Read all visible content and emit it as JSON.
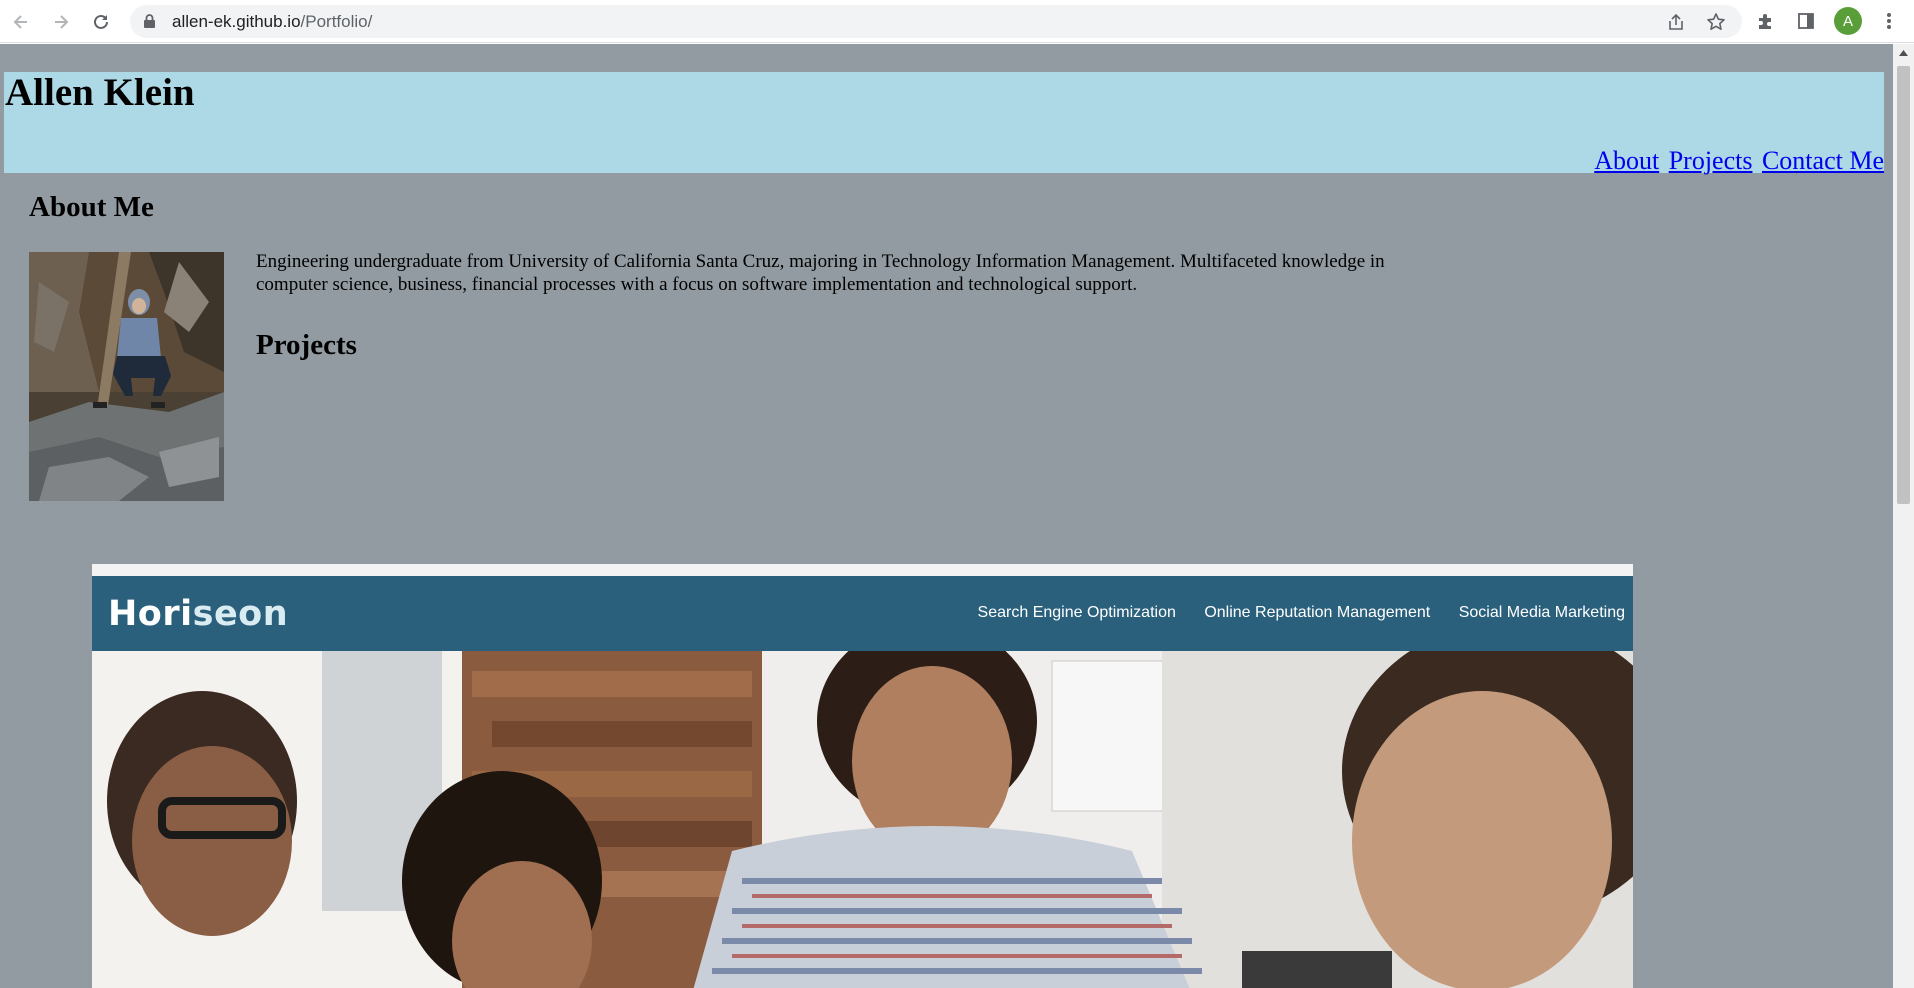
{
  "browser": {
    "url_host": "allen-ek.github.io",
    "url_path": "/Portfolio/",
    "avatar_letter": "A",
    "icons": [
      "back-arrow-icon",
      "forward-arrow-icon",
      "reload-icon",
      "lock-icon",
      "share-icon",
      "star-icon",
      "extensions-icon",
      "side-panel-icon",
      "kebab-menu-icon"
    ]
  },
  "header": {
    "title": "Allen Klein",
    "nav": [
      "About",
      "Projects",
      "Contact Me"
    ]
  },
  "about": {
    "heading": "About Me",
    "bio": "Engineering undergraduate from University of California Santa Cruz, majoring in Technology Information Management. Multifaceted knowledge in computer science, business, financial processes with a focus on software implementation and technological support."
  },
  "projects": {
    "heading": "Projects",
    "screenshot": {
      "brand_main": "Hori",
      "brand_light": "seon",
      "nav": [
        "Search Engine Optimization",
        "Online Reputation Management",
        "Social Media Marketing"
      ]
    }
  },
  "colors": {
    "page_bg": "#929ba1",
    "header_bg": "#add8e6",
    "link": "#0000ee",
    "horiseon_header": "#2a607c"
  }
}
